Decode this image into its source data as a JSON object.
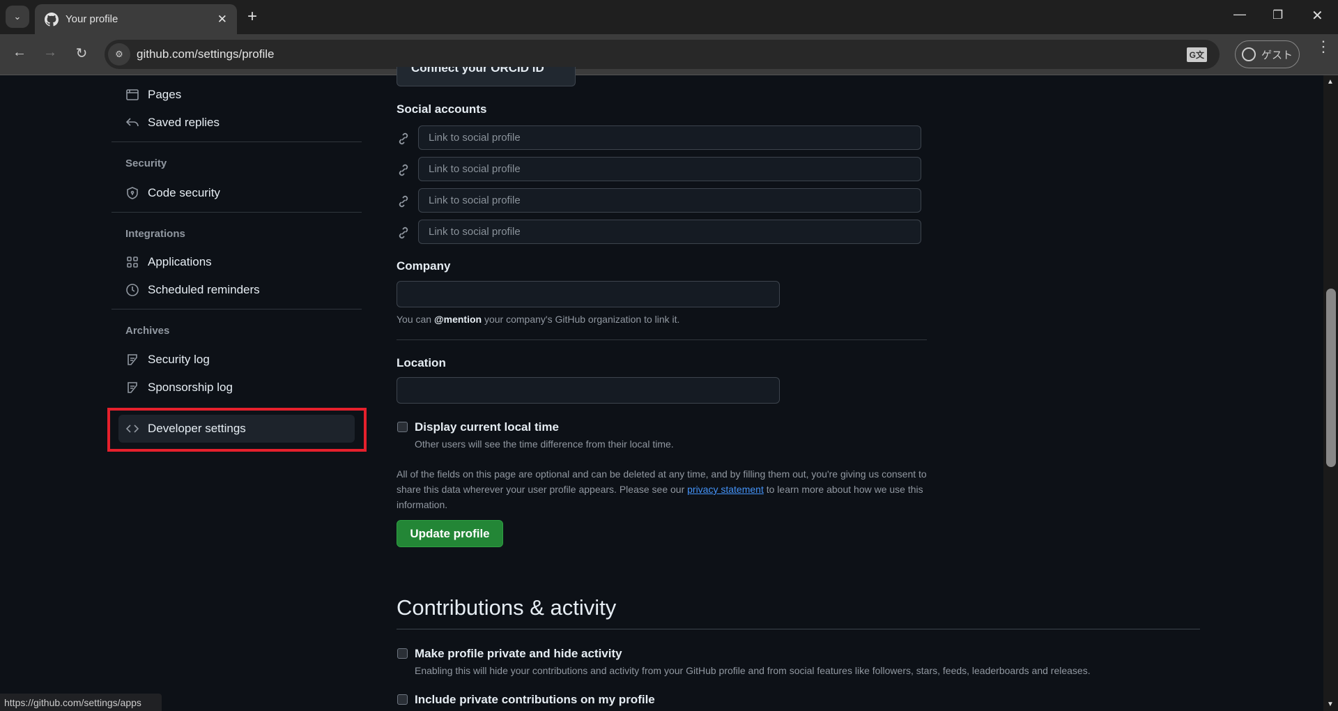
{
  "browser": {
    "tab_title": "Your profile",
    "url": "github.com/settings/profile",
    "profile_label": "ゲスト",
    "status_url": "https://github.com/settings/apps"
  },
  "sidebar": {
    "items_top": [
      {
        "label": "Pages",
        "icon": "browser-icon"
      },
      {
        "label": "Saved replies",
        "icon": "reply-icon"
      }
    ],
    "security": {
      "heading": "Security",
      "items": [
        {
          "label": "Code security",
          "icon": "shield-lock-icon"
        }
      ]
    },
    "integrations": {
      "heading": "Integrations",
      "items": [
        {
          "label": "Applications",
          "icon": "apps-icon"
        },
        {
          "label": "Scheduled reminders",
          "icon": "clock-icon"
        }
      ]
    },
    "archives": {
      "heading": "Archives",
      "items": [
        {
          "label": "Security log",
          "icon": "log-icon"
        },
        {
          "label": "Sponsorship log",
          "icon": "log-icon"
        }
      ]
    },
    "developer": {
      "label": "Developer settings",
      "icon": "code-icon",
      "highlight_color": "#e5202c"
    }
  },
  "main": {
    "orcid_button": "Connect your ORCID iD",
    "social": {
      "heading": "Social accounts",
      "placeholder": "Link to social profile"
    },
    "company": {
      "label": "Company",
      "value": "",
      "hint_pre": "You can ",
      "hint_bold": "@mention",
      "hint_post": " your company's GitHub organization to link it."
    },
    "location": {
      "label": "Location",
      "value": ""
    },
    "local_time": {
      "label": "Display current local time",
      "checked": false,
      "hint": "Other users will see the time difference from their local time."
    },
    "disclaimer": {
      "pre": "All of the fields on this page are optional and can be deleted at any time, and by filling them out, you're giving us consent to share this data wherever your user profile appears. Please see our ",
      "link": "privacy statement",
      "post": " to learn more about how we use this information."
    },
    "update_button": "Update profile",
    "contributions": {
      "heading": "Contributions & activity",
      "private": {
        "label": "Make profile private and hide activity",
        "checked": false,
        "hint": "Enabling this will hide your contributions and activity from your GitHub profile and from social features like followers, stars, feeds, leaderboards and releases."
      },
      "include_private": {
        "label": "Include private contributions on my profile",
        "checked": false
      }
    }
  },
  "colors": {
    "accent_green": "#238636",
    "link": "#4493f8"
  }
}
